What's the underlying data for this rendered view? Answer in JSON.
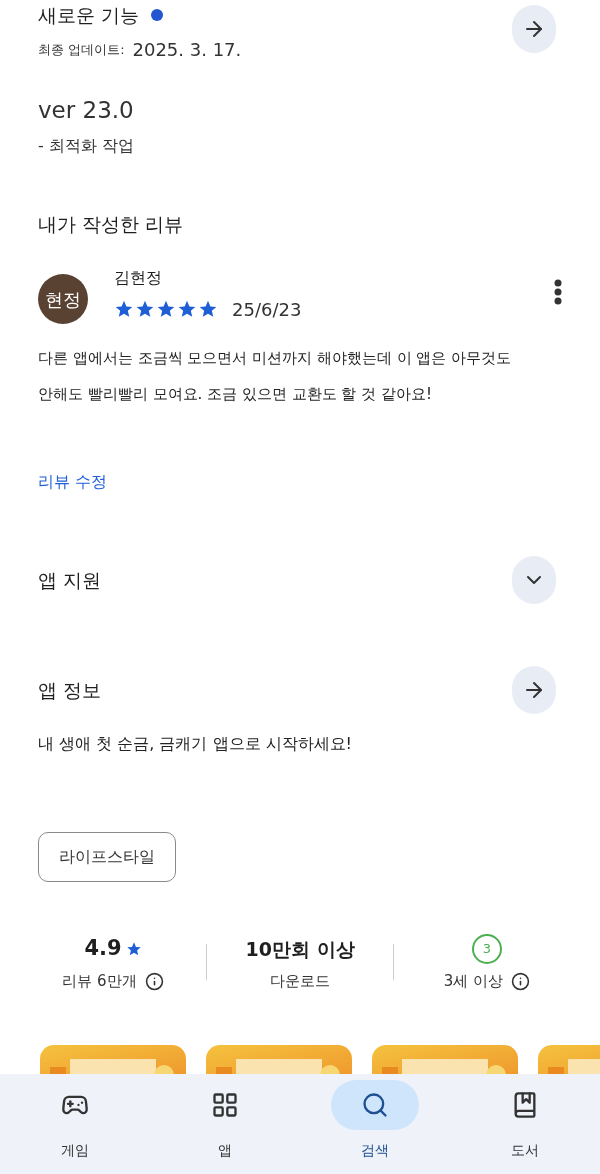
{
  "whats_new": {
    "title": "새로운 기능",
    "has_new": true,
    "updated_label": "최종 업데이트:",
    "updated_date": "2025. 3. 17.",
    "version": "ver 23.0",
    "notes": "- 최적화 작업"
  },
  "my_review": {
    "section_title": "내가 작성한 리뷰",
    "avatar_text": "현정",
    "name": "김현정",
    "stars": 5,
    "date": "25/6/23",
    "text": "다른 앱에서는 조금씩 모으면서 미션까지 해야했는데 이 앱은 아무것도 안해도 빨리빨리 모여요. 조금 있으면 교환도 할 것 같아요!",
    "edit_link": "리뷰 수정"
  },
  "app_support": {
    "title": "앱 지원",
    "expanded": false
  },
  "app_info": {
    "title": "앱 정보",
    "description": "내 생애 첫 순금, 금캐기 앱으로 시작하세요!",
    "tags": [
      "라이프스타일"
    ]
  },
  "stats": [
    {
      "kind": "rating",
      "value": "4.9",
      "label": "리뷰 6만개",
      "info": true
    },
    {
      "kind": "plain",
      "value": "10만회 이상",
      "label": "다운로드",
      "info": false
    },
    {
      "kind": "age",
      "value": "3",
      "label": "3세 이상",
      "info": true
    }
  ],
  "bottom_nav": [
    {
      "kind": "games",
      "label": "게임",
      "selected": false
    },
    {
      "kind": "apps",
      "label": "앱",
      "selected": false
    },
    {
      "kind": "search",
      "label": "검색",
      "selected": true
    },
    {
      "kind": "books",
      "label": "도서",
      "selected": false
    }
  ]
}
